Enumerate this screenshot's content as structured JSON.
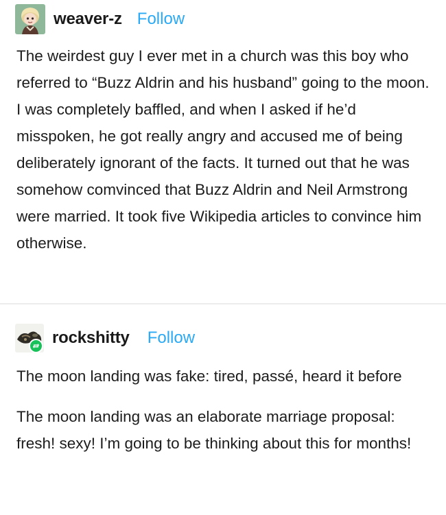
{
  "posts": [
    {
      "username": "weaver-z",
      "follow_label": "Follow",
      "paragraphs": [
        "The weirdest guy I ever met in a church was this boy who referred to “Buzz Aldrin and his husband” going to the moon. I was completely baffled, and when I asked if he’d misspoken, he got really angry and accused me of being deliberately ignorant of the facts. It turned out that he was somehow comvinced that Buzz Aldrin and Neil Armstrong were married. It took five Wikipedia articles to convince him otherwise."
      ],
      "avatar": "cartoon-character-avatar"
    },
    {
      "username": "rockshitty",
      "follow_label": "Follow",
      "paragraphs": [
        "The moon landing was fake: tired, passé, heard it before",
        "The moon landing was an elaborate marriage proposal: fresh! sexy! I’m going to be thinking about this for months!"
      ],
      "avatar": "rock-photo-avatar",
      "badge_icon": "reblog-icon"
    }
  ],
  "colors": {
    "follow": "#2aa9f5",
    "text": "#1c1c1c",
    "reblog_badge": "#19c15b"
  }
}
